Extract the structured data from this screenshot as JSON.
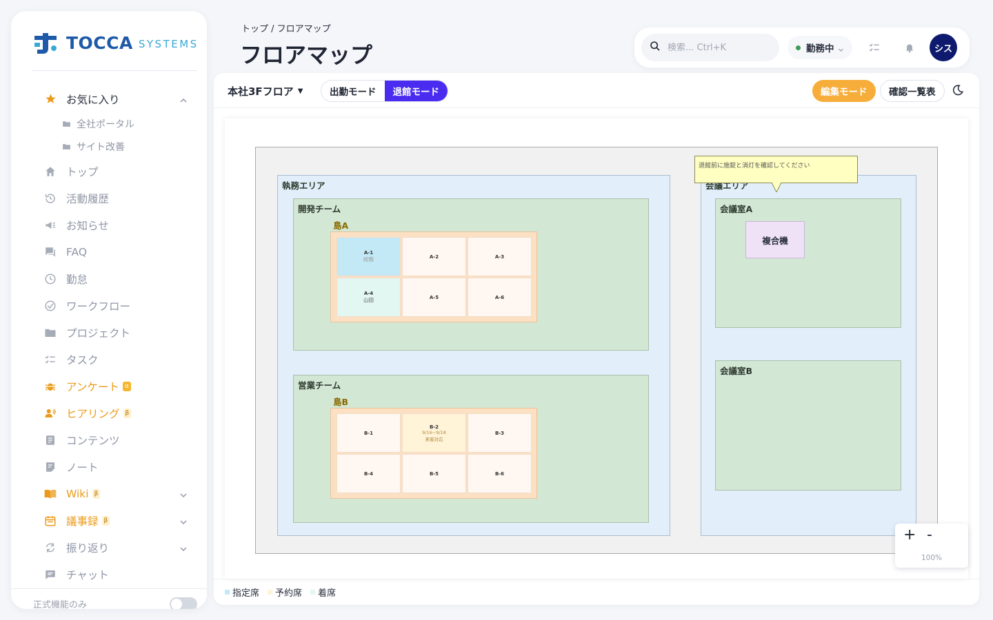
{
  "brand": {
    "word1": "TOCCA",
    "word2": "SYSTEMS"
  },
  "sidebar": {
    "favorites": {
      "label": "お気に入り",
      "children": [
        "全社ポータル",
        "サイト改善"
      ]
    },
    "items": [
      {
        "label": "トップ"
      },
      {
        "label": "活動履歴"
      },
      {
        "label": "お知らせ"
      },
      {
        "label": "FAQ"
      },
      {
        "label": "勤怠"
      },
      {
        "label": "ワークフロー"
      },
      {
        "label": "プロジェクト"
      },
      {
        "label": "タスク"
      },
      {
        "label": "アンケート",
        "badge": "α"
      },
      {
        "label": "ヒアリング",
        "badge": "β"
      },
      {
        "label": "コンテンツ"
      },
      {
        "label": "ノート"
      },
      {
        "label": "Wiki",
        "badge": "β"
      },
      {
        "label": "議事録",
        "badge": "β"
      },
      {
        "label": "振り返り"
      },
      {
        "label": "チャット"
      }
    ],
    "footer": {
      "label": "正式機能のみ"
    }
  },
  "header": {
    "breadcrumb": "トップ / フロアマップ",
    "title": "フロアマップ",
    "search_placeholder": "検索... Ctrl+K",
    "status": "勤務中",
    "avatar": "シス"
  },
  "toolbar": {
    "floor": "本社3Fフロア",
    "mode_attendance": "出勤モード",
    "mode_leave": "退館モード",
    "edit": "編集モード",
    "confirm_list": "確認一覧表"
  },
  "map": {
    "work_area": "執務エリア",
    "meeting_area": "会議エリア",
    "dev_team": "開発チーム",
    "sales_team": "営業チーム",
    "island_a": "島A",
    "island_b": "島B",
    "room_a": "会議室A",
    "room_b": "会議室B",
    "device": "複合機",
    "note": "退館前に施錠と消灯を確認してください",
    "seats_a": [
      {
        "id": "A-1",
        "name": "総務"
      },
      {
        "id": "A-2",
        "name": ""
      },
      {
        "id": "A-3",
        "name": ""
      },
      {
        "id": "A-4",
        "name": "山田"
      },
      {
        "id": "A-5",
        "name": ""
      },
      {
        "id": "A-6",
        "name": ""
      }
    ],
    "seats_b": [
      {
        "id": "B-1",
        "name": ""
      },
      {
        "id": "B-2",
        "name": "9/16~9/18",
        "name2": "来客対応"
      },
      {
        "id": "B-3",
        "name": ""
      },
      {
        "id": "B-4",
        "name": ""
      },
      {
        "id": "B-5",
        "name": ""
      },
      {
        "id": "B-6",
        "name": ""
      }
    ]
  },
  "zoom": {
    "in": "+",
    "out": "-",
    "level": "100%"
  },
  "legend": {
    "assigned": "指定席",
    "reserved": "予約席",
    "occupied": "着席"
  },
  "colors": {
    "primary": "#4a2cf0",
    "accent": "#f7ad3a",
    "seat_assigned": "#c3e9f6",
    "seat_reserved": "#fff3d8",
    "seat_occupied": "#e2f6f2"
  },
  "icons": [
    "star-icon",
    "folder-icon",
    "home-icon",
    "history-icon",
    "megaphone-icon",
    "faq-icon",
    "clock-icon",
    "check-circle-icon",
    "folder-icon",
    "tasks-icon",
    "bug-icon",
    "people-icon",
    "document-icon",
    "note-icon",
    "book-icon",
    "calendar-icon",
    "refresh-icon",
    "chat-icon",
    "search-icon",
    "bell-icon",
    "moon-icon",
    "chevron-down-icon",
    "chevron-up-icon"
  ]
}
